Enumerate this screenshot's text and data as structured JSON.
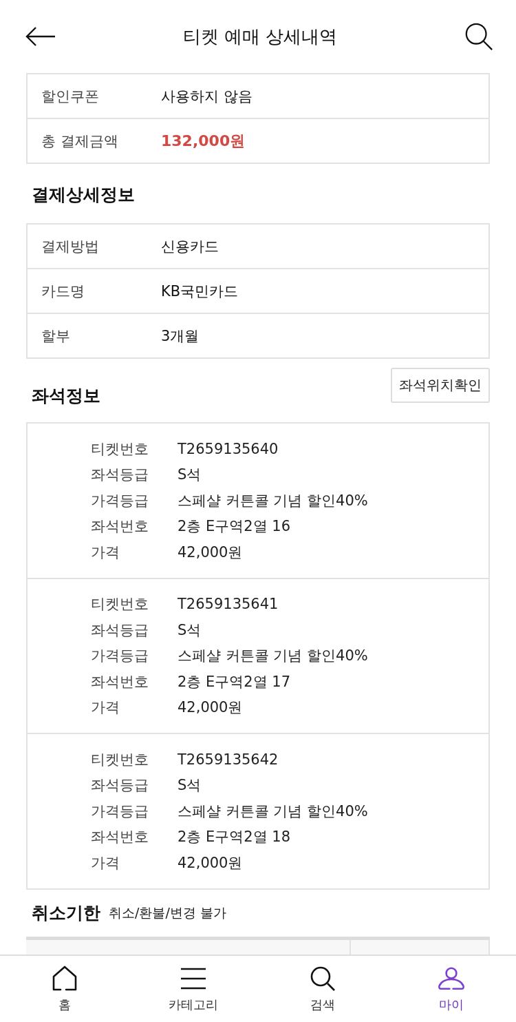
{
  "header": {
    "title": "티켓 예매 상세내역"
  },
  "summary": [
    {
      "label": "할인쿠폰",
      "value": "사용하지 않음",
      "highlight": false
    },
    {
      "label": "총 결제금액",
      "value": "132,000원",
      "highlight": true
    }
  ],
  "payment": {
    "title": "결제상세정보",
    "rows": [
      {
        "label": "결제방법",
        "value": "신용카드"
      },
      {
        "label": "카드명",
        "value": "KB국민카드"
      },
      {
        "label": "할부",
        "value": "3개월"
      }
    ]
  },
  "seats": {
    "title": "좌석정보",
    "button": "좌석위치확인",
    "tickets": [
      {
        "fields": [
          {
            "label": "티켓번호",
            "value": "T2659135640"
          },
          {
            "label": "좌석등급",
            "value": "S석"
          },
          {
            "label": "가격등급",
            "value": "스페샬 커튼콜 기념 할인40%"
          },
          {
            "label": "좌석번호",
            "value": "2층 E구역2열 16"
          },
          {
            "label": "가격",
            "value": "42,000원"
          }
        ]
      },
      {
        "fields": [
          {
            "label": "티켓번호",
            "value": "T2659135641"
          },
          {
            "label": "좌석등급",
            "value": "S석"
          },
          {
            "label": "가격등급",
            "value": "스페샬 커튼콜 기념 할인40%"
          },
          {
            "label": "좌석번호",
            "value": "2층 E구역2열 17"
          },
          {
            "label": "가격",
            "value": "42,000원"
          }
        ]
      },
      {
        "fields": [
          {
            "label": "티켓번호",
            "value": "T2659135642"
          },
          {
            "label": "좌석등급",
            "value": "S석"
          },
          {
            "label": "가격등급",
            "value": "스페샬 커튼콜 기념 할인40%"
          },
          {
            "label": "좌석번호",
            "value": "2층 E구역2열 18"
          },
          {
            "label": "가격",
            "value": "42,000원"
          }
        ]
      }
    ]
  },
  "cancel": {
    "title": "취소기한",
    "note": "취소/환불/변경 불가"
  },
  "nav": [
    {
      "label": "홈",
      "kind": "home",
      "selected": false
    },
    {
      "label": "카테고리",
      "kind": "menu",
      "selected": false
    },
    {
      "label": "검색",
      "kind": "search",
      "selected": false
    },
    {
      "label": "마이",
      "kind": "person",
      "selected": true
    }
  ]
}
